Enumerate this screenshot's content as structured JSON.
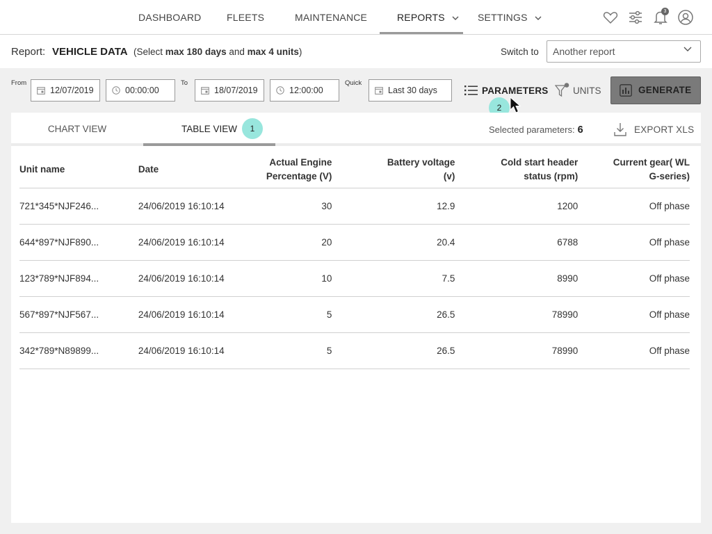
{
  "nav": {
    "items": [
      {
        "label": "DASHBOARD"
      },
      {
        "label": "FLEETS"
      },
      {
        "label": "MAINTENANCE"
      },
      {
        "label": "REPORTS"
      },
      {
        "label": "SETTINGS"
      }
    ],
    "active": "REPORTS",
    "icons": [
      "heart-icon",
      "sliders-icon",
      "bell-icon",
      "user-icon"
    ],
    "notification_count": "3"
  },
  "report": {
    "label": "Report:",
    "title": "VEHICLE DATA",
    "hint_prefix": "(Select ",
    "hint_days": "max 180 days",
    "hint_and": " and ",
    "hint_units": "max 4 units",
    "hint_suffix": ")",
    "switch_label": "Switch to",
    "switch_value": "Another report"
  },
  "filters": {
    "from_label": "From",
    "from_date": "12/07/2019",
    "from_time": "00:00:00",
    "to_label": "To",
    "to_date": "18/07/2019",
    "to_time": "12:00:00",
    "quick_label": "Quick",
    "quick_value": "Last 30 days",
    "parameters_label": "PARAMETERS",
    "units_label": "UNITS",
    "generate_label": "GENERATE"
  },
  "callouts": {
    "one": "1",
    "two": "2"
  },
  "view": {
    "tabs": [
      {
        "label": "CHART VIEW"
      },
      {
        "label": "TABLE VIEW"
      }
    ],
    "active_tab": "TABLE VIEW",
    "selected_params_label": "Selected parameters:",
    "selected_params_count": "6",
    "export_label": "EXPORT XLS"
  },
  "table": {
    "headers": {
      "unit": "Unit name",
      "date": "Date",
      "engine_l1": "Actual Engine",
      "engine_l2": "Percentage (V)",
      "battery_l1": "Battery voltage",
      "battery_l2": "(v)",
      "cold_l1": "Cold start header",
      "cold_l2": "status (rpm)",
      "gear_l1": "Current gear( WL",
      "gear_l2": "G-series)"
    },
    "rows": [
      {
        "unit": "721*345*NJF246...",
        "date": "24/06/2019 16:10:14",
        "engine": "30",
        "battery": "12.9",
        "cold": "1200",
        "gear": "Off phase"
      },
      {
        "unit": "644*897*NJF890...",
        "date": "24/06/2019 16:10:14",
        "engine": "20",
        "battery": "20.4",
        "cold": "6788",
        "gear": "Off phase"
      },
      {
        "unit": "123*789*NJF894...",
        "date": "24/06/2019 16:10:14",
        "engine": "10",
        "battery": "7.5",
        "cold": "8990",
        "gear": "Off phase"
      },
      {
        "unit": "567*897*NJF567...",
        "date": "24/06/2019 16:10:14",
        "engine": "5",
        "battery": "26.5",
        "cold": "78990",
        "gear": "Off phase"
      },
      {
        "unit": "342*789*N89899...",
        "date": "24/06/2019 16:10:14",
        "engine": "5",
        "battery": "26.5",
        "cold": "78990",
        "gear": "Off phase"
      }
    ]
  }
}
